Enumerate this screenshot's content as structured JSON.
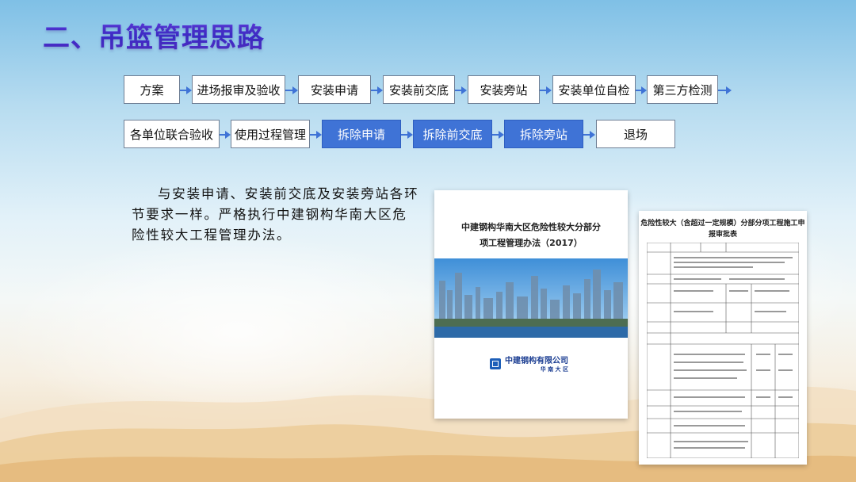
{
  "slide": {
    "title": "二、吊篮管理思路",
    "flow_row1": [
      "方案",
      "进场报审及验收",
      "安装申请",
      "安装前交底",
      "安装旁站",
      "安装单位自检",
      "第三方检测"
    ],
    "flow_row2": [
      "各单位联合验收",
      "使用过程管理",
      "拆除申请",
      "拆除前交底",
      "拆除旁站",
      "退场"
    ],
    "highlighted_color": "#3f73d6",
    "paragraph": "与安装申请、安装前交底及安装旁站各环节要求一样。严格执行中建钢构华南大区危险性较大工程管理办法。"
  },
  "doc_cover": {
    "title_line1": "中建钢构华南大区危险性较大分部分",
    "title_line2": "项工程管理办法（2017）",
    "company": "中建钢构有限公司",
    "division": "华 南 大 区"
  },
  "doc_form": {
    "title_line1": "危险性较大（含超过一定规模）分部分项工程施工申",
    "title_line2": "报审批表"
  }
}
